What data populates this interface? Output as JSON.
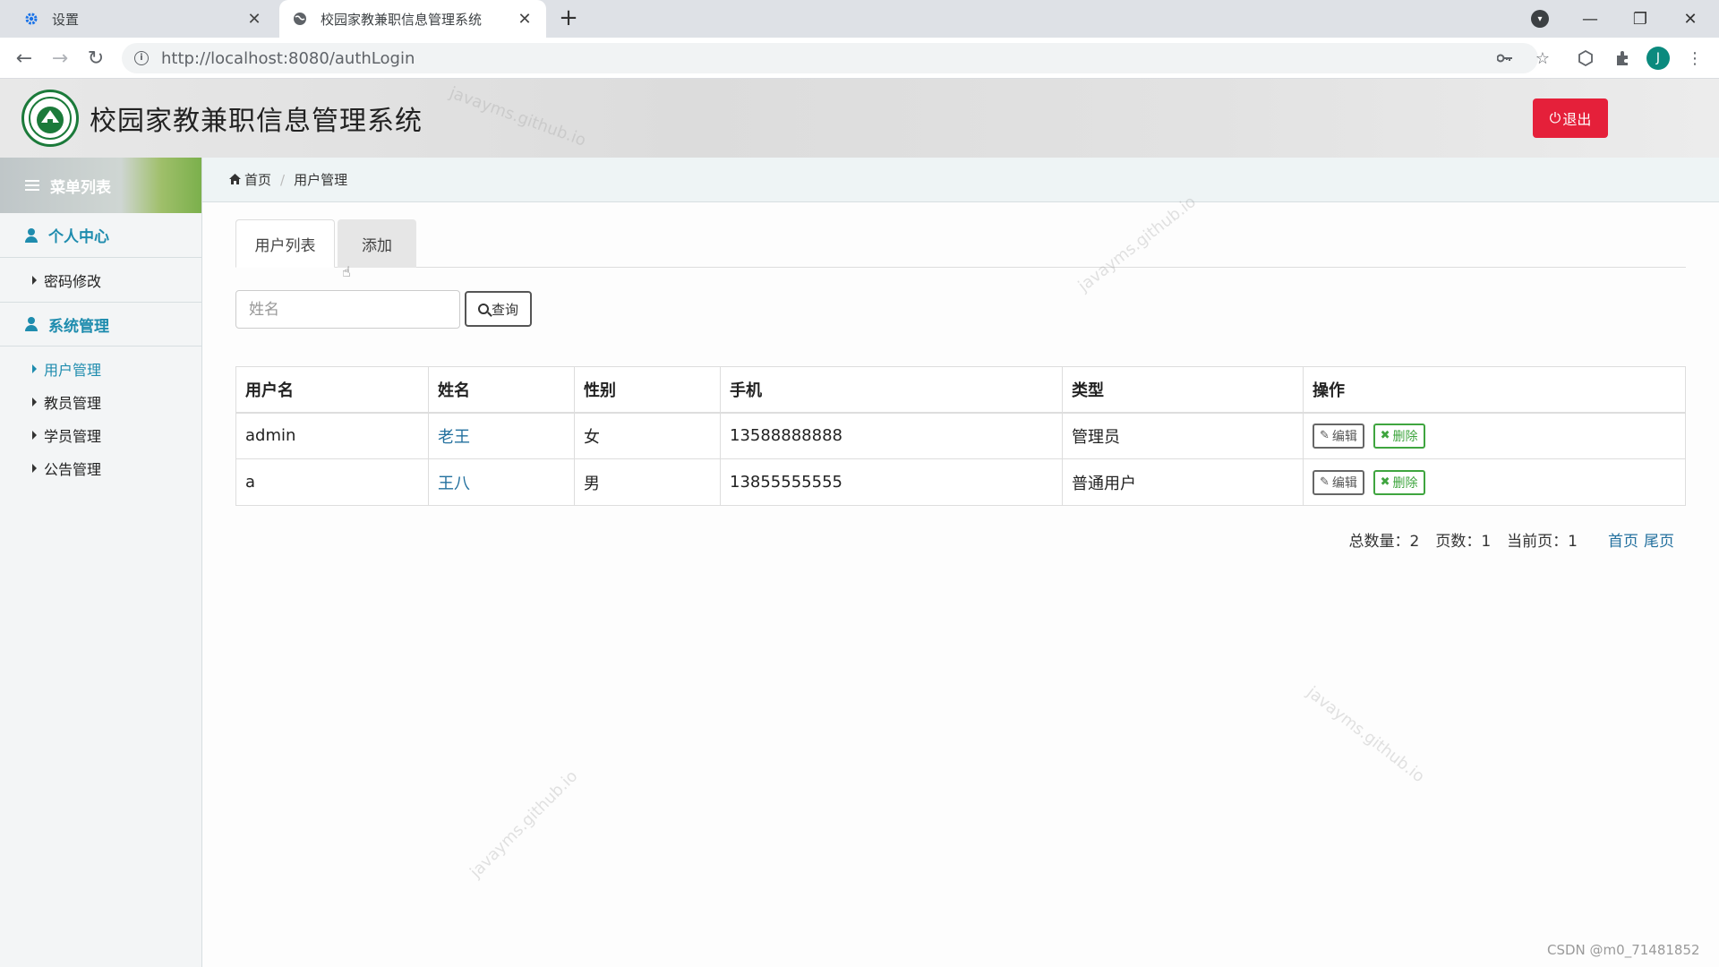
{
  "browser": {
    "tabs": [
      {
        "title": "设置",
        "icon": "gear-icon"
      },
      {
        "title": "校园家教兼职信息管理系统",
        "icon": "globe-icon"
      }
    ],
    "new_tab_symbol": "+",
    "url_host": "http://localhost",
    "url_path": ":8080/authLogin",
    "profile_initial": "J"
  },
  "header": {
    "site_title": "校园家教兼职信息管理系统",
    "logout_label": "退出"
  },
  "sidebar": {
    "menu_title": "菜单列表",
    "groups": [
      {
        "label": "个人中心",
        "items": [
          {
            "label": "密码修改"
          }
        ]
      },
      {
        "label": "系统管理",
        "items": [
          {
            "label": "用户管理"
          },
          {
            "label": "教员管理"
          },
          {
            "label": "学员管理"
          },
          {
            "label": "公告管理"
          }
        ]
      }
    ]
  },
  "breadcrumb": {
    "home": "首页",
    "current": "用户管理"
  },
  "tabs": {
    "list": "用户列表",
    "add": "添加"
  },
  "search": {
    "placeholder": "姓名",
    "button": "查询"
  },
  "table": {
    "headers": [
      "用户名",
      "姓名",
      "性别",
      "手机",
      "类型",
      "操作"
    ],
    "rows": [
      {
        "username": "admin",
        "name": "老王",
        "gender": "女",
        "phone": "13588888888",
        "type": "管理员"
      },
      {
        "username": "a",
        "name": "王八",
        "gender": "男",
        "phone": "13855555555",
        "type": "普通用户"
      }
    ],
    "edit_label": "编辑",
    "delete_label": "删除"
  },
  "pagination": {
    "total_label": "总数量：2",
    "pages_label": "页数：1",
    "current_label": "当前页：1",
    "first": "首页",
    "last": "尾页"
  },
  "watermark": "javayms.github.io",
  "footer_watermark": "CSDN @m0_71481852",
  "colors": {
    "accent": "#1e8cae",
    "logout": "#e5203a",
    "delete": "#3fa53f"
  }
}
